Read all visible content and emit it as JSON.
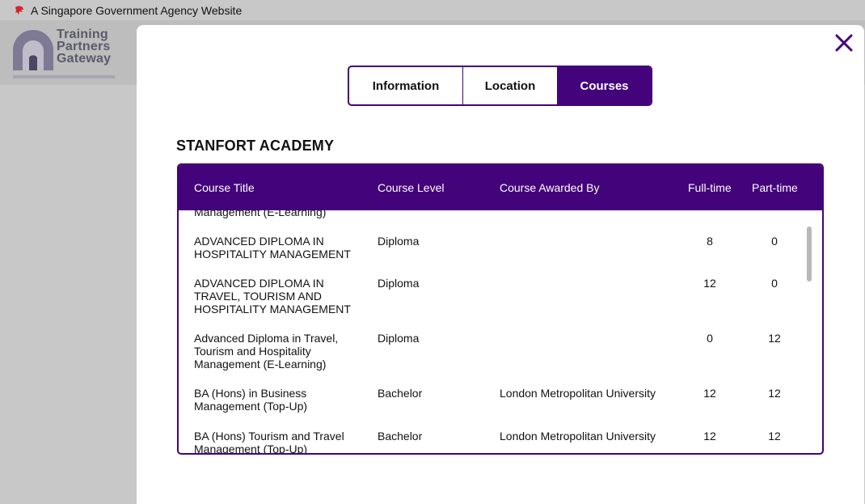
{
  "gov_bar": {
    "text": "A Singapore Government Agency Website",
    "icon": "lion-head-icon"
  },
  "logo": {
    "line1": "Training",
    "line2": "Partners",
    "line3": "Gateway"
  },
  "modal": {
    "tabs": [
      {
        "label": "Information",
        "active": false
      },
      {
        "label": "Location",
        "active": false
      },
      {
        "label": "Courses",
        "active": true
      }
    ],
    "title": "STANFORT ACADEMY",
    "table": {
      "headers": [
        "Course Title",
        "Course Level",
        "Course Awarded By",
        "Full-time",
        "Part-time"
      ],
      "partial_top": "Management (E-Learning)",
      "rows": [
        {
          "title": "ADVANCED DIPLOMA IN HOSPITALITY MANAGEMENT",
          "level": "Diploma",
          "awarded_by": "",
          "full_time": "8",
          "part_time": "0"
        },
        {
          "title": "ADVANCED DIPLOMA IN TRAVEL, TOURISM AND HOSPITALITY MANAGEMENT",
          "level": "Diploma",
          "awarded_by": "",
          "full_time": "12",
          "part_time": "0"
        },
        {
          "title": "Advanced Diploma in Travel, Tourism and Hospitality Management (E-Learning)",
          "level": "Diploma",
          "awarded_by": "",
          "full_time": "0",
          "part_time": "12"
        },
        {
          "title": "BA (Hons) in Business Management (Top-Up)",
          "level": "Bachelor",
          "awarded_by": "London Metropolitan University",
          "full_time": "12",
          "part_time": "12"
        },
        {
          "title": "BA (Hons) Tourism and Travel Management (Top-Up)",
          "level": "Bachelor",
          "awarded_by": "London Metropolitan University",
          "full_time": "12",
          "part_time": "12"
        }
      ]
    },
    "close_icon": "close-icon"
  },
  "colors": {
    "brand": "#43037a",
    "overlay": "#c8c8c8"
  }
}
